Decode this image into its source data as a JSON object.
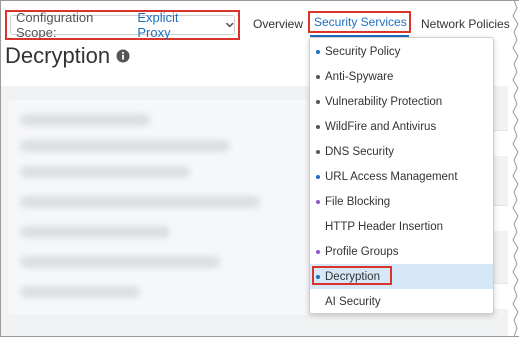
{
  "scope": {
    "label": "Configuration Scope:",
    "value": "Explicit Proxy"
  },
  "nav": {
    "overview": "Overview",
    "security_services": "Security Services",
    "network_policies": "Network Policies"
  },
  "page": {
    "title": "Decryption"
  },
  "colors": {
    "accent": "#1f6fbf",
    "highlight_border": "#d9342b",
    "selected_bg": "#d6e8f7"
  },
  "menu": {
    "items": [
      {
        "label": "Security Policy",
        "dot": "#1f6fbf"
      },
      {
        "label": "Anti-Spyware",
        "dot": "#555555"
      },
      {
        "label": "Vulnerability Protection",
        "dot": "#555555"
      },
      {
        "label": "WildFire and Antivirus",
        "dot": "#555555"
      },
      {
        "label": "DNS Security",
        "dot": "#555555"
      },
      {
        "label": "URL Access Management",
        "dot": "#1f6fbf"
      },
      {
        "label": "File Blocking",
        "dot": "#8a5cc7"
      },
      {
        "label": "HTTP Header Insertion",
        "dot": ""
      },
      {
        "label": "Profile Groups",
        "dot": "#8a5cc7"
      },
      {
        "label": "Decryption",
        "dot": "#1f6fbf",
        "selected": true
      },
      {
        "label": "AI Security",
        "dot": ""
      }
    ]
  }
}
